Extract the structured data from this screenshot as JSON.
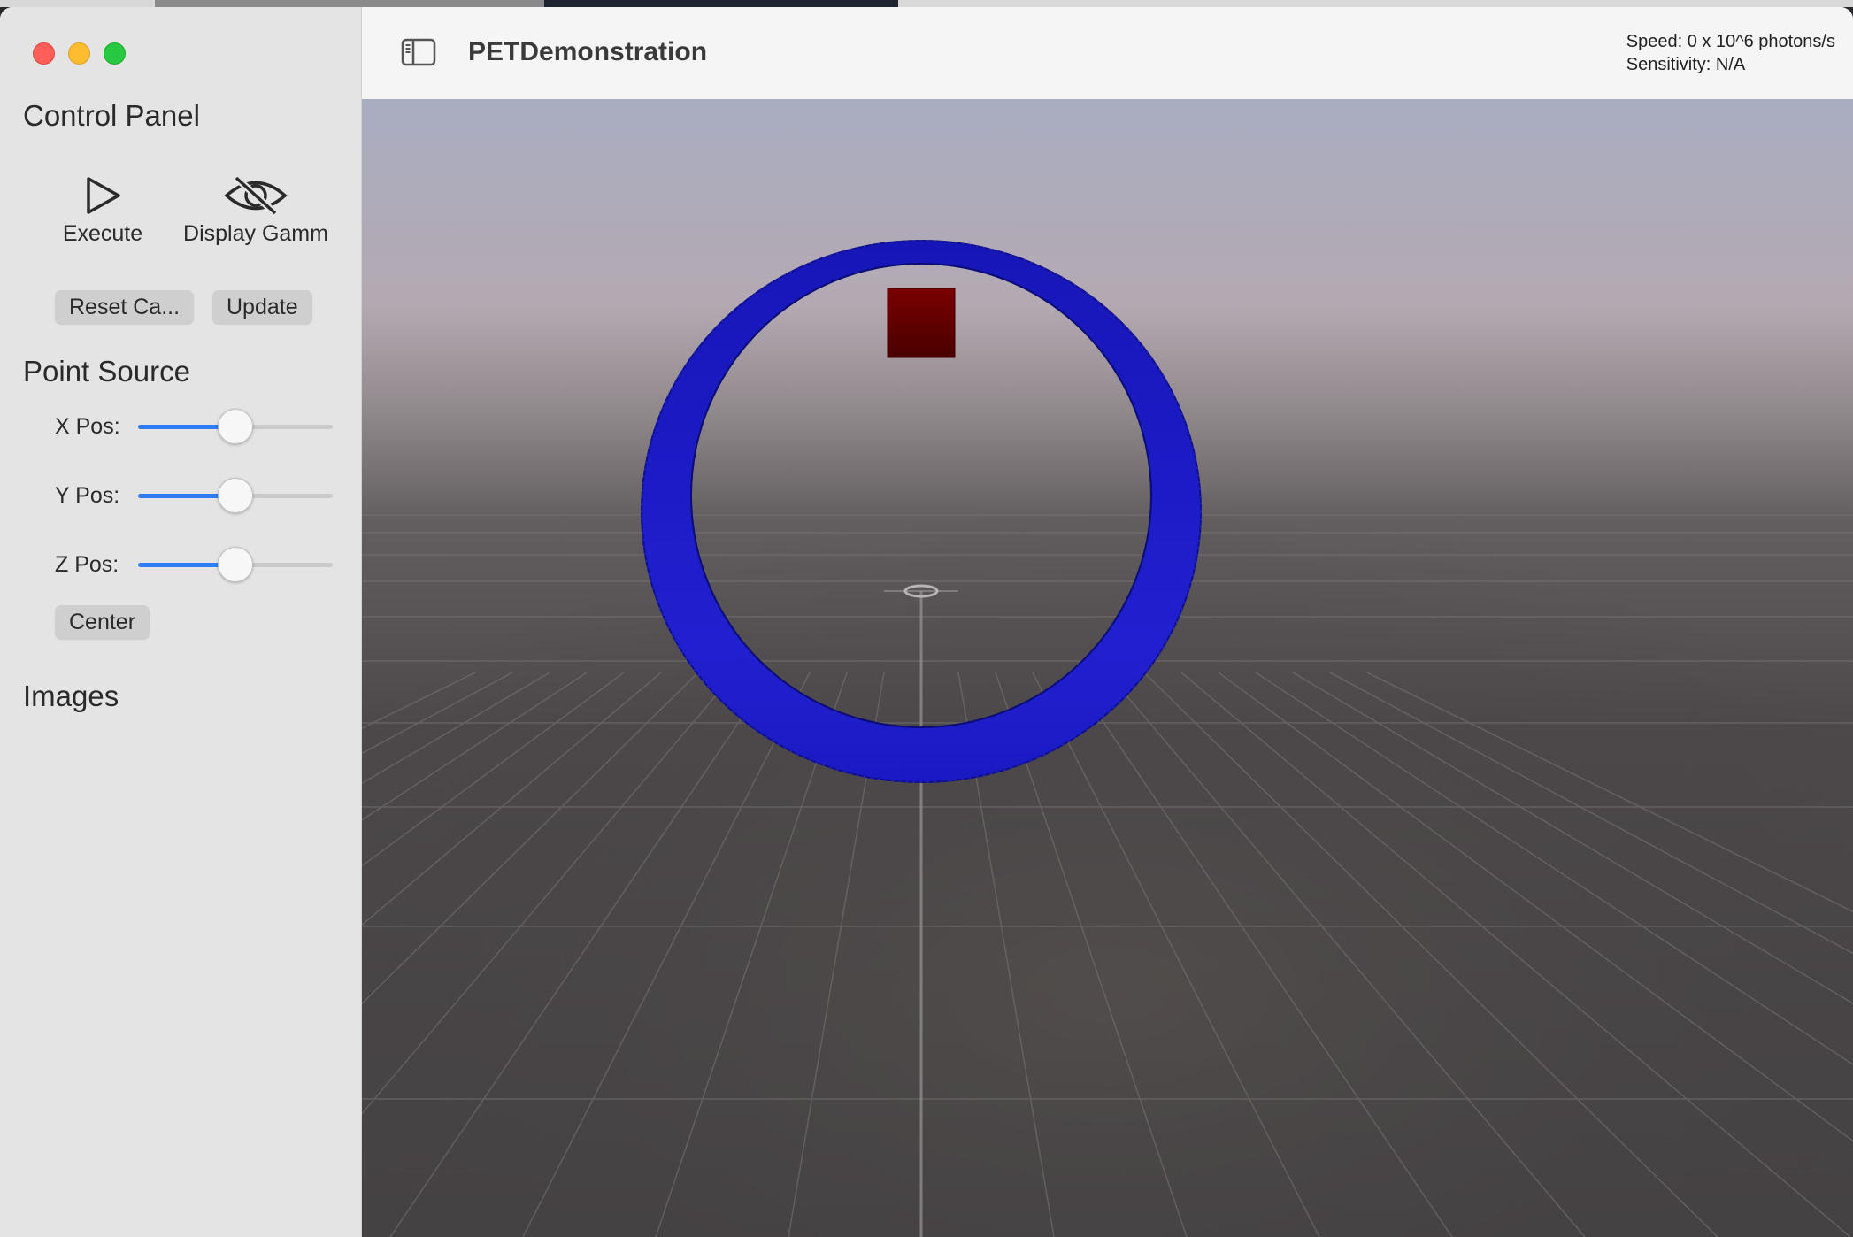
{
  "window": {
    "title": "PETDemonstration",
    "status": {
      "speed": "Speed: 0 x 10^6 photons/s",
      "sensitivity": "Sensitivity: N/A"
    }
  },
  "sidebar": {
    "control_panel_title": "Control Panel",
    "execute_label": "Execute",
    "display_gamma_label": "Display Gamm",
    "reset_camera_label": "Reset Ca...",
    "update_label": "Update",
    "point_source_title": "Point Source",
    "sliders": [
      {
        "label": "X Pos:",
        "value": 0.5
      },
      {
        "label": "Y Pos:",
        "value": 0.5
      },
      {
        "label": "Z Pos:",
        "value": 0.5
      }
    ],
    "center_label": "Center",
    "images_title": "Images"
  },
  "scene": {
    "ring_color": "#1a1acc",
    "source_color": "#8b0000",
    "floor_color": "#4a4648",
    "sky_color": "#a9adc1"
  },
  "icons": {
    "execute": "play-icon",
    "display_gamma": "eye-slash-icon",
    "sidebar_toggle": "sidebar-toggle-icon"
  }
}
